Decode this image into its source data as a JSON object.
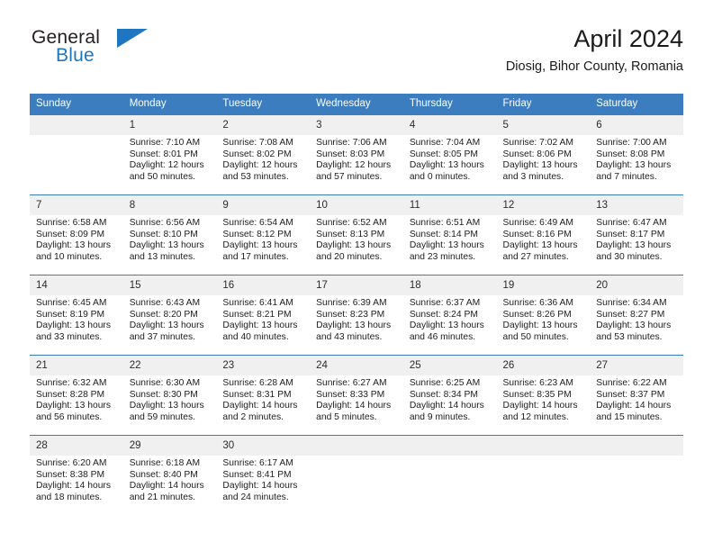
{
  "brand": {
    "name_top": "General",
    "name_bottom": "Blue",
    "accent_color": "#1d76bf",
    "flag_icon": "brand-flag-icon"
  },
  "header": {
    "title": "April 2024",
    "subtitle": "Diosig, Bihor County, Romania"
  },
  "calendar": {
    "header_bg": "#3b7dbf",
    "daynum_bg": "#f0f0f0",
    "weekdays": [
      "Sunday",
      "Monday",
      "Tuesday",
      "Wednesday",
      "Thursday",
      "Friday",
      "Saturday"
    ],
    "weeks": [
      [
        {
          "day": "",
          "sunrise": "",
          "sunset": "",
          "daylight1": "",
          "daylight2": "",
          "empty": true
        },
        {
          "day": "1",
          "sunrise": "Sunrise: 7:10 AM",
          "sunset": "Sunset: 8:01 PM",
          "daylight1": "Daylight: 12 hours",
          "daylight2": "and 50 minutes."
        },
        {
          "day": "2",
          "sunrise": "Sunrise: 7:08 AM",
          "sunset": "Sunset: 8:02 PM",
          "daylight1": "Daylight: 12 hours",
          "daylight2": "and 53 minutes."
        },
        {
          "day": "3",
          "sunrise": "Sunrise: 7:06 AM",
          "sunset": "Sunset: 8:03 PM",
          "daylight1": "Daylight: 12 hours",
          "daylight2": "and 57 minutes."
        },
        {
          "day": "4",
          "sunrise": "Sunrise: 7:04 AM",
          "sunset": "Sunset: 8:05 PM",
          "daylight1": "Daylight: 13 hours",
          "daylight2": "and 0 minutes."
        },
        {
          "day": "5",
          "sunrise": "Sunrise: 7:02 AM",
          "sunset": "Sunset: 8:06 PM",
          "daylight1": "Daylight: 13 hours",
          "daylight2": "and 3 minutes."
        },
        {
          "day": "6",
          "sunrise": "Sunrise: 7:00 AM",
          "sunset": "Sunset: 8:08 PM",
          "daylight1": "Daylight: 13 hours",
          "daylight2": "and 7 minutes."
        }
      ],
      [
        {
          "day": "7",
          "sunrise": "Sunrise: 6:58 AM",
          "sunset": "Sunset: 8:09 PM",
          "daylight1": "Daylight: 13 hours",
          "daylight2": "and 10 minutes."
        },
        {
          "day": "8",
          "sunrise": "Sunrise: 6:56 AM",
          "sunset": "Sunset: 8:10 PM",
          "daylight1": "Daylight: 13 hours",
          "daylight2": "and 13 minutes."
        },
        {
          "day": "9",
          "sunrise": "Sunrise: 6:54 AM",
          "sunset": "Sunset: 8:12 PM",
          "daylight1": "Daylight: 13 hours",
          "daylight2": "and 17 minutes."
        },
        {
          "day": "10",
          "sunrise": "Sunrise: 6:52 AM",
          "sunset": "Sunset: 8:13 PM",
          "daylight1": "Daylight: 13 hours",
          "daylight2": "and 20 minutes."
        },
        {
          "day": "11",
          "sunrise": "Sunrise: 6:51 AM",
          "sunset": "Sunset: 8:14 PM",
          "daylight1": "Daylight: 13 hours",
          "daylight2": "and 23 minutes."
        },
        {
          "day": "12",
          "sunrise": "Sunrise: 6:49 AM",
          "sunset": "Sunset: 8:16 PM",
          "daylight1": "Daylight: 13 hours",
          "daylight2": "and 27 minutes."
        },
        {
          "day": "13",
          "sunrise": "Sunrise: 6:47 AM",
          "sunset": "Sunset: 8:17 PM",
          "daylight1": "Daylight: 13 hours",
          "daylight2": "and 30 minutes."
        }
      ],
      [
        {
          "day": "14",
          "sunrise": "Sunrise: 6:45 AM",
          "sunset": "Sunset: 8:19 PM",
          "daylight1": "Daylight: 13 hours",
          "daylight2": "and 33 minutes."
        },
        {
          "day": "15",
          "sunrise": "Sunrise: 6:43 AM",
          "sunset": "Sunset: 8:20 PM",
          "daylight1": "Daylight: 13 hours",
          "daylight2": "and 37 minutes."
        },
        {
          "day": "16",
          "sunrise": "Sunrise: 6:41 AM",
          "sunset": "Sunset: 8:21 PM",
          "daylight1": "Daylight: 13 hours",
          "daylight2": "and 40 minutes."
        },
        {
          "day": "17",
          "sunrise": "Sunrise: 6:39 AM",
          "sunset": "Sunset: 8:23 PM",
          "daylight1": "Daylight: 13 hours",
          "daylight2": "and 43 minutes."
        },
        {
          "day": "18",
          "sunrise": "Sunrise: 6:37 AM",
          "sunset": "Sunset: 8:24 PM",
          "daylight1": "Daylight: 13 hours",
          "daylight2": "and 46 minutes."
        },
        {
          "day": "19",
          "sunrise": "Sunrise: 6:36 AM",
          "sunset": "Sunset: 8:26 PM",
          "daylight1": "Daylight: 13 hours",
          "daylight2": "and 50 minutes."
        },
        {
          "day": "20",
          "sunrise": "Sunrise: 6:34 AM",
          "sunset": "Sunset: 8:27 PM",
          "daylight1": "Daylight: 13 hours",
          "daylight2": "and 53 minutes."
        }
      ],
      [
        {
          "day": "21",
          "sunrise": "Sunrise: 6:32 AM",
          "sunset": "Sunset: 8:28 PM",
          "daylight1": "Daylight: 13 hours",
          "daylight2": "and 56 minutes."
        },
        {
          "day": "22",
          "sunrise": "Sunrise: 6:30 AM",
          "sunset": "Sunset: 8:30 PM",
          "daylight1": "Daylight: 13 hours",
          "daylight2": "and 59 minutes."
        },
        {
          "day": "23",
          "sunrise": "Sunrise: 6:28 AM",
          "sunset": "Sunset: 8:31 PM",
          "daylight1": "Daylight: 14 hours",
          "daylight2": "and 2 minutes."
        },
        {
          "day": "24",
          "sunrise": "Sunrise: 6:27 AM",
          "sunset": "Sunset: 8:33 PM",
          "daylight1": "Daylight: 14 hours",
          "daylight2": "and 5 minutes."
        },
        {
          "day": "25",
          "sunrise": "Sunrise: 6:25 AM",
          "sunset": "Sunset: 8:34 PM",
          "daylight1": "Daylight: 14 hours",
          "daylight2": "and 9 minutes."
        },
        {
          "day": "26",
          "sunrise": "Sunrise: 6:23 AM",
          "sunset": "Sunset: 8:35 PM",
          "daylight1": "Daylight: 14 hours",
          "daylight2": "and 12 minutes."
        },
        {
          "day": "27",
          "sunrise": "Sunrise: 6:22 AM",
          "sunset": "Sunset: 8:37 PM",
          "daylight1": "Daylight: 14 hours",
          "daylight2": "and 15 minutes."
        }
      ],
      [
        {
          "day": "28",
          "sunrise": "Sunrise: 6:20 AM",
          "sunset": "Sunset: 8:38 PM",
          "daylight1": "Daylight: 14 hours",
          "daylight2": "and 18 minutes."
        },
        {
          "day": "29",
          "sunrise": "Sunrise: 6:18 AM",
          "sunset": "Sunset: 8:40 PM",
          "daylight1": "Daylight: 14 hours",
          "daylight2": "and 21 minutes."
        },
        {
          "day": "30",
          "sunrise": "Sunrise: 6:17 AM",
          "sunset": "Sunset: 8:41 PM",
          "daylight1": "Daylight: 14 hours",
          "daylight2": "and 24 minutes."
        },
        {
          "day": "",
          "sunrise": "",
          "sunset": "",
          "daylight1": "",
          "daylight2": "",
          "empty": true
        },
        {
          "day": "",
          "sunrise": "",
          "sunset": "",
          "daylight1": "",
          "daylight2": "",
          "empty": true
        },
        {
          "day": "",
          "sunrise": "",
          "sunset": "",
          "daylight1": "",
          "daylight2": "",
          "empty": true
        },
        {
          "day": "",
          "sunrise": "",
          "sunset": "",
          "daylight1": "",
          "daylight2": "",
          "empty": true
        }
      ]
    ]
  }
}
